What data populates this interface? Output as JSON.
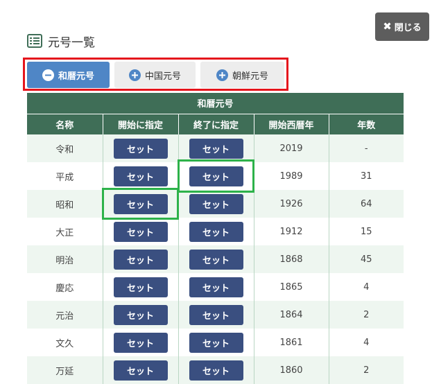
{
  "close_button": {
    "label": "閉じる",
    "icon": "close-icon"
  },
  "page_title": "元号一覧",
  "tabs": [
    {
      "label": "和暦元号",
      "active": true,
      "icon": "minus-circle-icon"
    },
    {
      "label": "中国元号",
      "active": false,
      "icon": "plus-circle-icon"
    },
    {
      "label": "朝鮮元号",
      "active": false,
      "icon": "plus-circle-icon"
    }
  ],
  "table": {
    "caption": "和暦元号",
    "headers": [
      "名称",
      "開始に指定",
      "終了に指定",
      "開始西暦年",
      "年数"
    ],
    "set_label": "セット",
    "rows": [
      {
        "name": "令和",
        "start_year": "2019",
        "years": "-"
      },
      {
        "name": "平成",
        "start_year": "1989",
        "years": "31"
      },
      {
        "name": "昭和",
        "start_year": "1926",
        "years": "64"
      },
      {
        "name": "大正",
        "start_year": "1912",
        "years": "15"
      },
      {
        "name": "明治",
        "start_year": "1868",
        "years": "45"
      },
      {
        "name": "慶応",
        "start_year": "1865",
        "years": "4"
      },
      {
        "name": "元治",
        "start_year": "1864",
        "years": "2"
      },
      {
        "name": "文久",
        "start_year": "1861",
        "years": "4"
      },
      {
        "name": "万延",
        "start_year": "1860",
        "years": "2"
      }
    ]
  },
  "colors": {
    "header_bg": "#3f6e57",
    "set_button_bg": "#3a4f80",
    "active_tab_bg": "#4f86c6",
    "tab_highlight": "#e5141c",
    "cell_highlight": "#2db24a"
  }
}
